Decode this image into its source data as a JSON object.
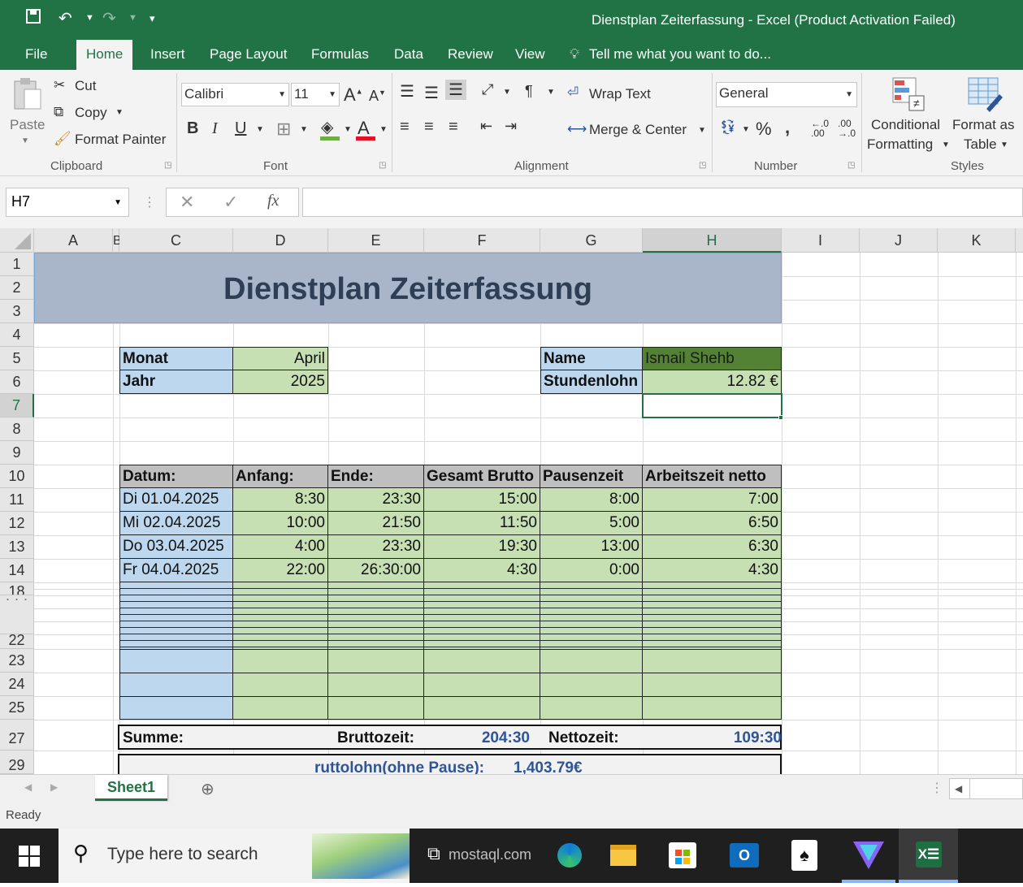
{
  "window": {
    "title": "Dienstplan Zeiterfassung - Excel (Product Activation Failed)"
  },
  "menu": {
    "tabs": [
      "File",
      "Home",
      "Insert",
      "Page Layout",
      "Formulas",
      "Data",
      "Review",
      "View"
    ],
    "active_tab": "Home",
    "tell_me": "Tell me what you want to do..."
  },
  "ribbon": {
    "clipboard": {
      "paste": "Paste",
      "cut": "Cut",
      "copy": "Copy",
      "format_painter": "Format Painter",
      "label": "Clipboard"
    },
    "font": {
      "name": "Calibri",
      "size": "11",
      "bold": "B",
      "italic": "I",
      "underline": "U",
      "label": "Font"
    },
    "alignment": {
      "wrap_text": "Wrap Text",
      "merge_center": "Merge & Center",
      "label": "Alignment"
    },
    "number": {
      "format": "General",
      "percent": "%",
      "comma": ",",
      "label": "Number"
    },
    "styles": {
      "conditional_1": "Conditional",
      "conditional_2": "Formatting",
      "format_as_1": "Format as",
      "format_as_2": "Table",
      "label": "Styles"
    }
  },
  "formula_bar": {
    "name_box": "H7",
    "fx": "fx",
    "formula": ""
  },
  "columns": [
    "A",
    "B",
    "C",
    "D",
    "E",
    "F",
    "G",
    "H",
    "I",
    "J",
    "K"
  ],
  "rows": [
    "1",
    "2",
    "3",
    "4",
    "5",
    "6",
    "7",
    "8",
    "9",
    "10",
    "11",
    "12",
    "13",
    "14",
    "18",
    "22",
    "23",
    "24",
    "25",
    "27",
    "29"
  ],
  "sheet": {
    "banner_title": "Dienstplan Zeiterfassung",
    "monat_label": "Monat",
    "monat_value": "April",
    "jahr_label": "Jahr",
    "jahr_value": "2025",
    "name_label": "Name",
    "name_value": "Ismail Shehb",
    "stundenlohn_label": "Stundenlohn",
    "stundenlohn_value": "12.82 €",
    "table_headers": [
      "Datum:",
      "Anfang:",
      "Ende:",
      "Gesamt Brutto",
      "Pausenzeit",
      "Arbeitszeit netto"
    ],
    "table_rows": [
      [
        "Di 01.04.2025",
        "8:30",
        "23:30",
        "15:00",
        "8:00",
        "7:00"
      ],
      [
        "Mi 02.04.2025",
        "10:00",
        "21:50",
        "11:50",
        "5:00",
        "6:50"
      ],
      [
        "Do 03.04.2025",
        "4:00",
        "23:30",
        "19:30",
        "13:00",
        "6:30"
      ],
      [
        "Fr 04.04.2025",
        "22:00",
        "26:30:00",
        "4:30",
        "0:00",
        "4:30"
      ]
    ],
    "summe_label": "Summe:",
    "brutto_label": "Bruttozeit:",
    "brutto_value": "204:30",
    "netto_label": "Nettozeit:",
    "netto_value": "109:30",
    "lohn_label": "ruttolohn(ohne Pause):",
    "lohn_value": "1,403.79€"
  },
  "sheet_tab": "Sheet1",
  "status": "Ready",
  "taskbar": {
    "search_placeholder": "Type here to search",
    "watermark": "mostaql.com"
  },
  "colors": {
    "excel_green": "#217346",
    "banner": "#a9b6c9",
    "blue_cell": "#bdd7ee",
    "green_cell": "#c6e0b4",
    "dark_green": "#548235",
    "header_gray": "#bfbfbf",
    "value_blue": "#2f5597"
  }
}
